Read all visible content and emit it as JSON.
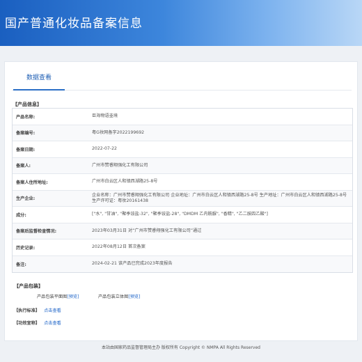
{
  "header": {
    "title": "国产普通化妆品备案信息"
  },
  "tab": {
    "label": "数据查看"
  },
  "product_info": {
    "section_title": "【产品信息】",
    "rows": [
      {
        "label": "产品名称:",
        "value": "巨海物语韭境"
      },
      {
        "label": "备案编号:",
        "value": "粤G妆网备字2022199692"
      },
      {
        "label": "备案日期:",
        "value": "2022-07-22"
      },
      {
        "label": "备案人:",
        "value": "广州市赞睿翔强化工有限公司"
      },
      {
        "label": "备案人住所地址:",
        "value": "广州市白云区人和镇西湖路25-8号"
      },
      {
        "label": "生产企业:",
        "value": "企业名称：广州市赞睿翔强化工有限公司 企业地址：广州市白云区人和镇西湖路25-8号 生产地址：广州市白云区人和镇西湖路25-8号 生产许可证：粤妆20161438"
      },
      {
        "label": "成分:",
        "value": "[\"水\", \"甘油\", \"聚季铵盐-32\", \"聚季铵盐-28\", \"DMDM 乙内酰脲\", \"香精\", \"乙二胺四乙酸\"]"
      },
      {
        "label": "备案后监督检查情况:",
        "value": "2023年03月31日 对“广州市赞睿翔强化工有限公司”通过"
      },
      {
        "label": "历史记录:",
        "value": "2022年08月12日 首次备案"
      },
      {
        "label": "备注:",
        "value": "2024-02-21 该产品已完成2023年度报告"
      }
    ]
  },
  "package": {
    "section_title": "【产品包装】",
    "flat_label": "产品包装平面图",
    "flat_link": "[预览]",
    "solid_label": "产品包装立体图",
    "solid_link": "[预览]"
  },
  "standard": {
    "section_title": "【执行标准】",
    "link": "点击查看"
  },
  "efficacy": {
    "section_title": "【功效宣称】",
    "link": "点击查看"
  },
  "footer": {
    "text": "本站由国家药品监督管理局主办 版权所有 Copyright © NMPA All Rights Reserved"
  }
}
